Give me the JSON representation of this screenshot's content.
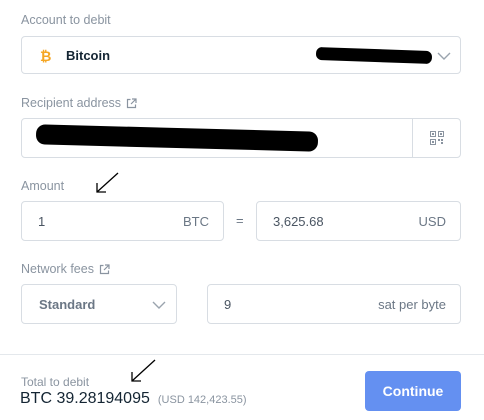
{
  "account": {
    "label": "Account to debit",
    "selected": "Bitcoin",
    "coin_color": "#f5a623"
  },
  "recipient": {
    "label": "Recipient address"
  },
  "amount": {
    "label": "Amount",
    "crypto_value": "1",
    "crypto_unit": "BTC",
    "equals": "=",
    "fiat_value": "3,625.68",
    "fiat_unit": "USD"
  },
  "fees": {
    "label": "Network fees",
    "speed": "Standard",
    "value": "9",
    "unit": "sat per byte"
  },
  "footer": {
    "total_label": "Total to debit",
    "total_crypto": "BTC 39.28194095",
    "total_fiat": "(USD 142,423.55)",
    "continue_label": "Continue",
    "continue_color": "#6490f1"
  }
}
